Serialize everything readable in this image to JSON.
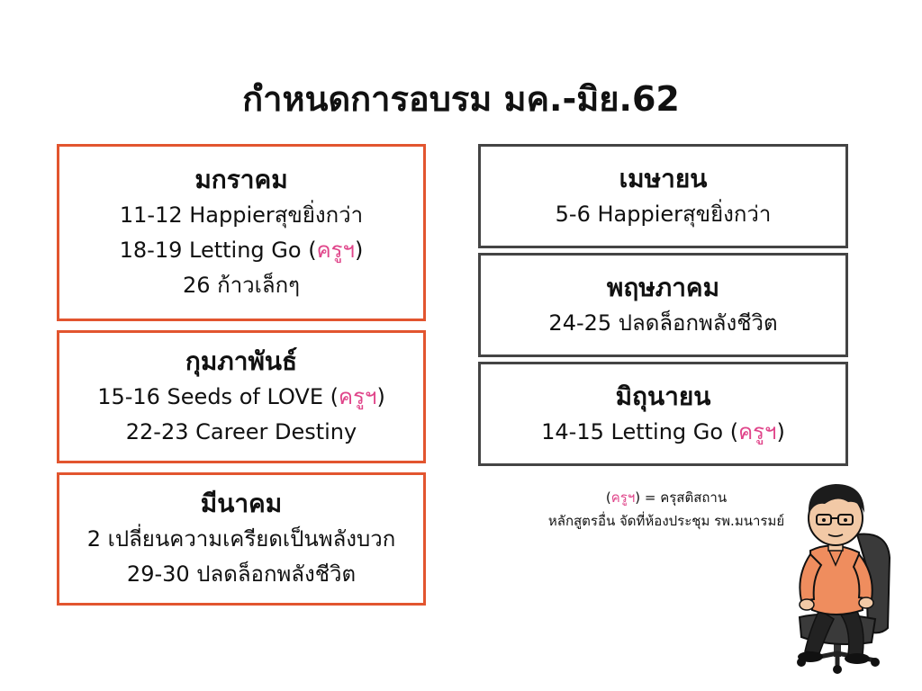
{
  "title": "กำหนดการอบรม มค.-มิย.62",
  "colors": {
    "left_border": "#e2552f",
    "right_border": "#444444",
    "highlight": "#e0458a"
  },
  "months": {
    "jan": {
      "name": "มกราคม",
      "l1": "11-12 Happierสุขยิ่งกว่า",
      "l2_pre": "18-19 Letting Go (",
      "l2_tag": "ครูฯ",
      "l2_post": ")",
      "l3": "26 ก้าวเล็กๆ"
    },
    "feb": {
      "name": "กุมภาพันธ์",
      "l1_pre": "15-16 Seeds of LOVE (",
      "l1_tag": "ครูฯ",
      "l1_post": ")",
      "l2": "22-23 Career Destiny"
    },
    "mar": {
      "name": "มีนาคม",
      "l1": "2 เปลี่ยนความเครียดเป็นพลังบวก",
      "l2": "29-30 ปลดล็อกพลังชีวิต"
    },
    "apr": {
      "name": "เมษายน",
      "l1": "5-6 Happierสุขยิ่งกว่า"
    },
    "may": {
      "name": "พฤษภาคม",
      "l1": "24-25 ปลดล็อกพลังชีวิต"
    },
    "jun": {
      "name": "มิถุนายน",
      "l1_pre": "14-15 Letting Go (",
      "l1_tag": "ครูฯ",
      "l1_post": ")"
    }
  },
  "note": {
    "l1_pre": "(",
    "l1_tag": "ครูฯ",
    "l1_post": ") = ครุสติสถาน",
    "l2": "หลักสูตรอื่น จัดที่ห้องประชุม รพ.มนารมย์"
  },
  "icons": {
    "cartoon": "man-in-office-chair-illustration"
  }
}
